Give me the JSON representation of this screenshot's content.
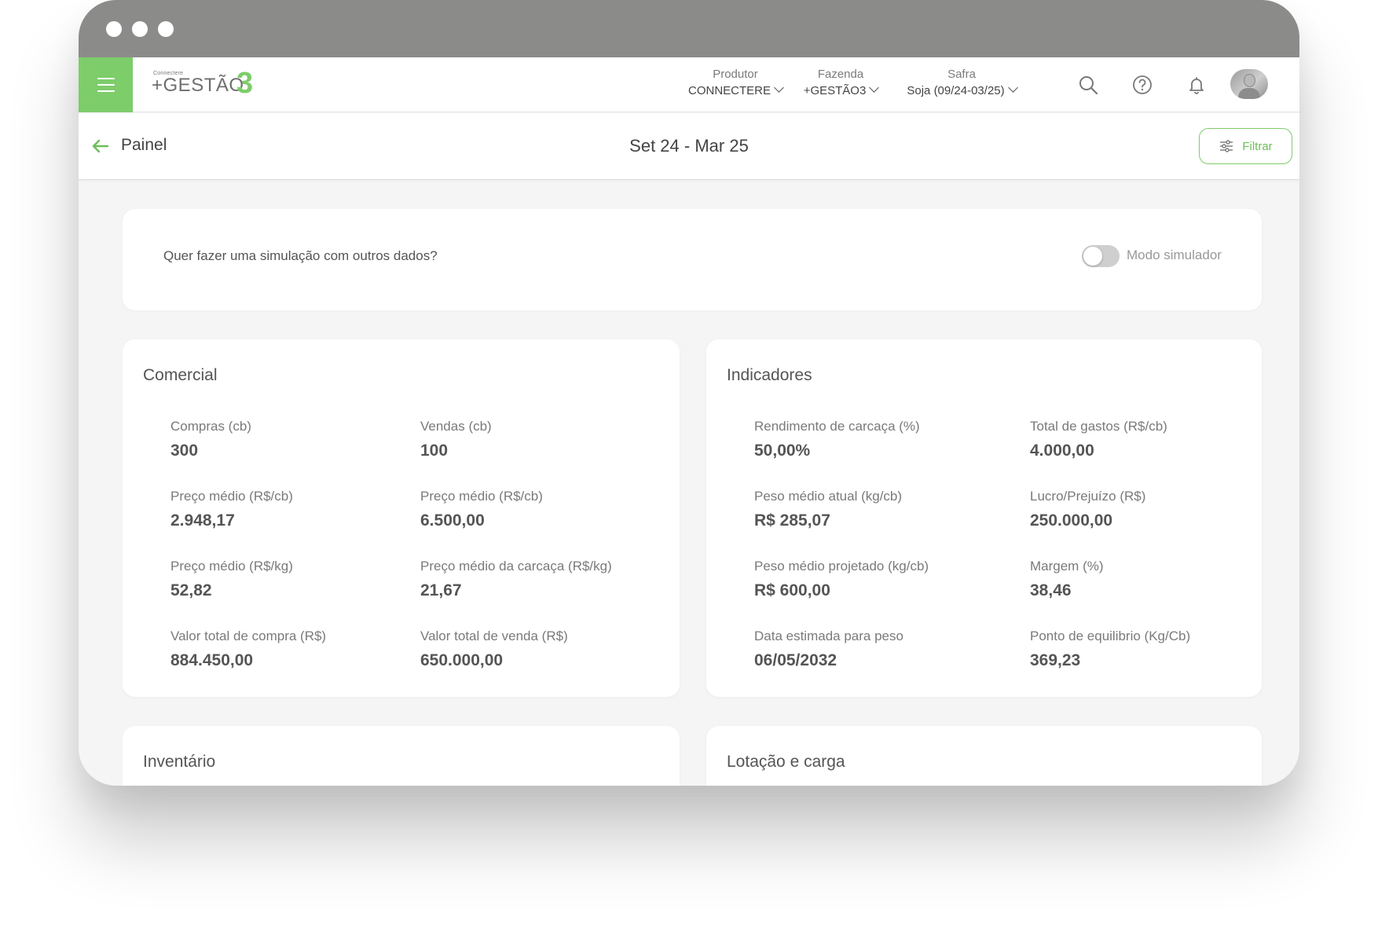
{
  "header": {
    "logo_small": "Connectere",
    "logo_text": "+GESTÃO",
    "logo_num": "3",
    "selectors": [
      {
        "label": "Produtor",
        "value": "CONNECTERE"
      },
      {
        "label": "Fazenda",
        "value": "+GESTÃO3"
      },
      {
        "label": "Safra",
        "value": "Soja (09/24-03/25)"
      }
    ],
    "icons": [
      "search-icon",
      "help-icon",
      "bell-icon"
    ]
  },
  "subheader": {
    "title": "Painel",
    "period": "Set 24 - Mar 25",
    "filter_label": "Filtrar"
  },
  "simulation": {
    "question": "Quer fazer uma simulação com outros dados?",
    "toggle_label": "Modo simulador",
    "enabled": false
  },
  "comercial": {
    "title": "Comercial",
    "metrics": [
      {
        "label": "Compras (cb)",
        "value": "300"
      },
      {
        "label": "Vendas (cb)",
        "value": "100"
      },
      {
        "label": "Preço médio (R$/cb)",
        "value": "2.948,17"
      },
      {
        "label": "Preço médio (R$/cb)",
        "value": "6.500,00"
      },
      {
        "label": "Preço médio (R$/kg)",
        "value": "52,82"
      },
      {
        "label": "Preço médio da carcaça (R$/kg)",
        "value": "21,67"
      },
      {
        "label": "Valor total de compra (R$)",
        "value": "884.450,00"
      },
      {
        "label": "Valor total de venda (R$)",
        "value": "650.000,00"
      }
    ]
  },
  "indicadores": {
    "title": "Indicadores",
    "metrics": [
      {
        "label": "Rendimento de carcaça (%)",
        "value": "50,00%"
      },
      {
        "label": "Total de gastos (R$/cb)",
        "value": "4.000,00"
      },
      {
        "label": "Peso médio atual (kg/cb)",
        "value": "R$ 285,07"
      },
      {
        "label": "Lucro/Prejuízo (R$)",
        "value": "250.000,00"
      },
      {
        "label": "Peso médio projetado (kg/cb)",
        "value": "R$ 600,00"
      },
      {
        "label": "Margem (%)",
        "value": "38,46"
      },
      {
        "label": "Data estimada para peso",
        "value": "06/05/2032"
      },
      {
        "label": "Ponto de equilibrio (Kg/Cb)",
        "value": "369,23"
      }
    ]
  },
  "inventario": {
    "title": "Inventário"
  },
  "lotacao": {
    "title": "Lotação e carga"
  },
  "colors": {
    "accent": "#7dcd6a",
    "titlebar": "#8b8c8a",
    "background": "#f5f5f5"
  }
}
